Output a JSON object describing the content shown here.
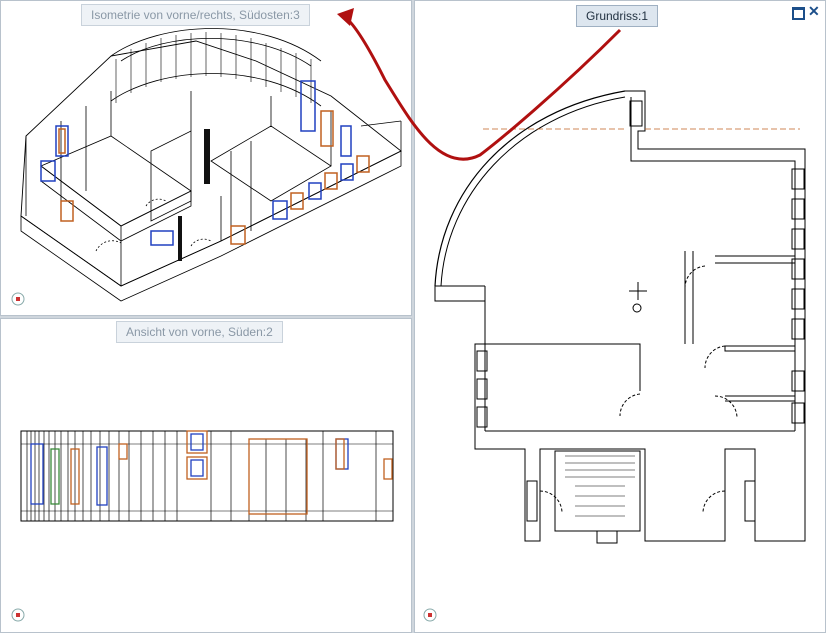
{
  "viewports": {
    "iso": {
      "label": "Isometrie von vorne/rechts, Südosten:3"
    },
    "front": {
      "label": "Ansicht von vorne, Süden:2"
    },
    "plan": {
      "label": "Grundriss:1"
    }
  },
  "window_controls": {
    "close_glyph": "✕"
  },
  "colors": {
    "accent_arrow": "#b01010",
    "wall": "#000000",
    "frame_blue": "#2040c0"
  }
}
